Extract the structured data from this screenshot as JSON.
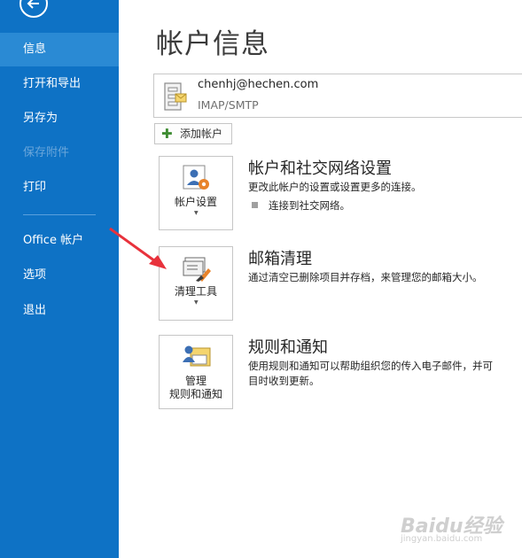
{
  "sidebar": {
    "items": [
      {
        "label": "信息"
      },
      {
        "label": "打开和导出"
      },
      {
        "label": "另存为"
      },
      {
        "label": "保存附件"
      },
      {
        "label": "打印"
      },
      {
        "label": "Office 帐户"
      },
      {
        "label": "选项"
      },
      {
        "label": "退出"
      }
    ],
    "active": "信息",
    "disabled": [
      "保存附件"
    ]
  },
  "main": {
    "title": "帐户信息",
    "account": {
      "email": "chenhj@hechen.com",
      "type": "IMAP/SMTP"
    },
    "add_account_label": "添加帐户",
    "sections": [
      {
        "tile_label": "帐户设置",
        "title": "帐户和社交网络设置",
        "description": "更改此帐户的设置或设置更多的连接。",
        "bullet": "连接到社交网络。"
      },
      {
        "tile_label": "清理工具",
        "title": "邮箱清理",
        "description": "通过清空已删除项目并存档，来管理您的邮箱大小。"
      },
      {
        "tile_label_line1": "管理",
        "tile_label_line2": "规则和通知",
        "title": "规则和通知",
        "description_line1": "使用规则和通知可以帮助组织您的传入电子邮件，并可",
        "description_line2": "目时收到更新。"
      }
    ]
  },
  "watermark": {
    "text": "Baidu经验",
    "url": "jingyan.baidu.com"
  },
  "colors": {
    "sidebar_bg": "#0e72c5",
    "sidebar_active": "#2a8ad4",
    "annotation_arrow": "#e8323c"
  }
}
